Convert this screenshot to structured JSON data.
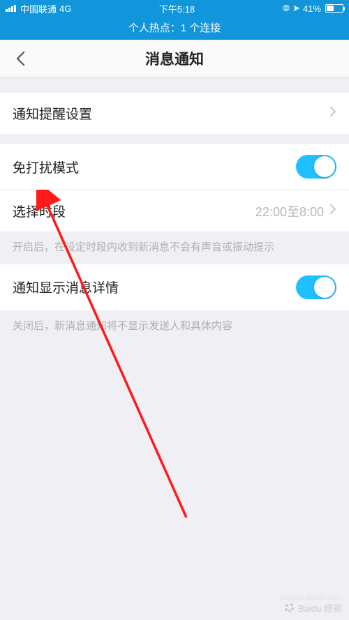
{
  "status": {
    "carrier": "中国联通",
    "network": "4G",
    "time": "下午5:18",
    "battery_pct": "41%"
  },
  "hotspot": "个人热点：1 个连接",
  "nav": {
    "title": "消息通知"
  },
  "cells": {
    "reminder": {
      "label": "通知提醒设置"
    },
    "dnd": {
      "label": "免打扰模式"
    },
    "period": {
      "label": "选择时段",
      "value": "22:00至8:00"
    },
    "detail": {
      "label": "通知显示消息详情"
    }
  },
  "notes": {
    "dnd_note": "开启后，在设定时段内收到新消息不会有声音或振动提示",
    "detail_note": "关闭后，新消息通知将不显示发送人和具体内容"
  },
  "watermark": {
    "brand": "Baidu 经验"
  }
}
